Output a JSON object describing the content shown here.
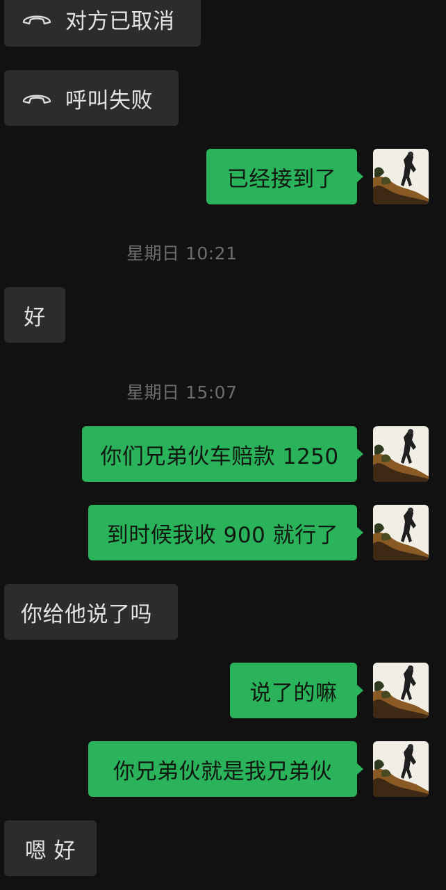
{
  "messages": [
    {
      "kind": "call",
      "side": "in",
      "text": "对方已取消",
      "icon": "hangup-phone-icon"
    },
    {
      "kind": "call",
      "side": "in",
      "text": "呼叫失败",
      "icon": "hangup-phone-icon"
    },
    {
      "kind": "text",
      "side": "out",
      "text": "已经接到了"
    },
    {
      "kind": "time",
      "text": "星期日 10:21"
    },
    {
      "kind": "text",
      "side": "in",
      "text": "好"
    },
    {
      "kind": "time",
      "text": "星期日 15:07"
    },
    {
      "kind": "text",
      "side": "out",
      "text": "你们兄弟伙车赔款 1250"
    },
    {
      "kind": "text",
      "side": "out",
      "text": "到时候我收 900 就行了"
    },
    {
      "kind": "text",
      "side": "in",
      "text": "你给他说了吗"
    },
    {
      "kind": "text",
      "side": "out",
      "text": "说了的嘛"
    },
    {
      "kind": "text",
      "side": "out",
      "text": "你兄弟伙就是我兄弟伙"
    },
    {
      "kind": "text",
      "side": "in",
      "text": "嗯 好"
    }
  ],
  "colors": {
    "background": "#111111",
    "incoming_bubble": "#2c2c2c",
    "outgoing_bubble": "#2ab35b",
    "timestamp_text": "#6e6e6e"
  },
  "avatar": {
    "icon": "user-avatar-photo"
  }
}
